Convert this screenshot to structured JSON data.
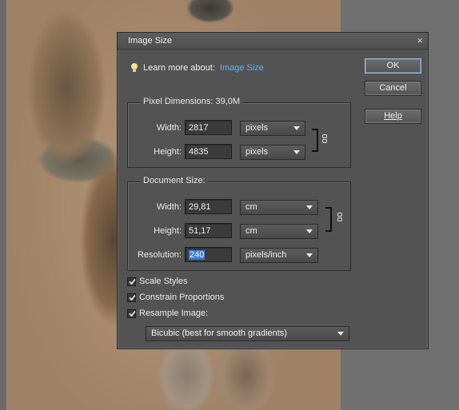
{
  "dialog": {
    "title": "Image Size",
    "close": "×"
  },
  "learn": {
    "text": "Learn more about:",
    "link": "Image Size"
  },
  "pixel_dimensions": {
    "title": "Pixel Dimensions:  39,0M",
    "width_label": "Width:",
    "width_value": "2817",
    "width_unit": "pixels",
    "height_label": "Height:",
    "height_value": "4835",
    "height_unit": "pixels"
  },
  "document_size": {
    "title": "Document Size:",
    "width_label": "Width:",
    "width_value": "29,81",
    "width_unit": "cm",
    "height_label": "Height:",
    "height_value": "51,17",
    "height_unit": "cm",
    "resolution_label": "Resolution:",
    "resolution_value": "240",
    "resolution_unit": "pixels/inch"
  },
  "buttons": {
    "ok": "OK",
    "cancel": "Cancel",
    "help": "Help"
  },
  "options": {
    "scale_styles": "Scale Styles",
    "constrain_proportions": "Constrain Proportions",
    "resample_image": "Resample Image:",
    "resample_method": "Bicubic (best for smooth gradients)"
  },
  "colors": {
    "dialog_bg": "#535353",
    "link": "#5cb4ff",
    "selection": "#3a7bd5"
  }
}
